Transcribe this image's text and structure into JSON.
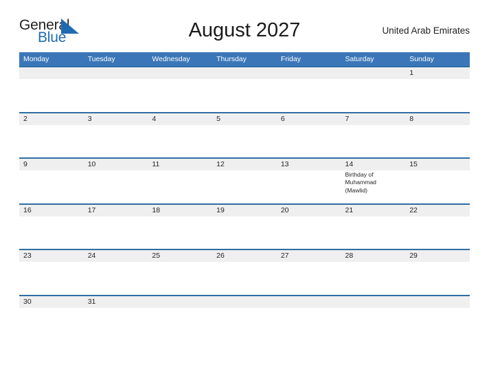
{
  "brand": {
    "name_part1": "General",
    "name_part2": "Blue",
    "color_dark": "#231f20",
    "color_blue": "#1f6bb0"
  },
  "header": {
    "title": "August 2027",
    "region": "United Arab Emirates"
  },
  "theme": {
    "header_bar": "#3b76b8",
    "row_divider": "#2e6da4",
    "day_band": "#efefef",
    "page_background": "#ffffff",
    "text": "#231f20"
  },
  "calendar": {
    "month": "August",
    "year": "2027",
    "day_headers": [
      "Monday",
      "Tuesday",
      "Wednesday",
      "Thursday",
      "Friday",
      "Saturday",
      "Sunday"
    ],
    "weeks": [
      {
        "days": [
          {
            "num": "",
            "events": []
          },
          {
            "num": "",
            "events": []
          },
          {
            "num": "",
            "events": []
          },
          {
            "num": "",
            "events": []
          },
          {
            "num": "",
            "events": []
          },
          {
            "num": "",
            "events": []
          },
          {
            "num": "1",
            "events": []
          }
        ]
      },
      {
        "days": [
          {
            "num": "2",
            "events": []
          },
          {
            "num": "3",
            "events": []
          },
          {
            "num": "4",
            "events": []
          },
          {
            "num": "5",
            "events": []
          },
          {
            "num": "6",
            "events": []
          },
          {
            "num": "7",
            "events": []
          },
          {
            "num": "8",
            "events": []
          }
        ]
      },
      {
        "days": [
          {
            "num": "9",
            "events": []
          },
          {
            "num": "10",
            "events": []
          },
          {
            "num": "11",
            "events": []
          },
          {
            "num": "12",
            "events": []
          },
          {
            "num": "13",
            "events": []
          },
          {
            "num": "14",
            "events": [
              "Birthday of",
              "Muhammad",
              "(Mawlid)"
            ]
          },
          {
            "num": "15",
            "events": []
          }
        ]
      },
      {
        "days": [
          {
            "num": "16",
            "events": []
          },
          {
            "num": "17",
            "events": []
          },
          {
            "num": "18",
            "events": []
          },
          {
            "num": "19",
            "events": []
          },
          {
            "num": "20",
            "events": []
          },
          {
            "num": "21",
            "events": []
          },
          {
            "num": "22",
            "events": []
          }
        ]
      },
      {
        "days": [
          {
            "num": "23",
            "events": []
          },
          {
            "num": "24",
            "events": []
          },
          {
            "num": "25",
            "events": []
          },
          {
            "num": "26",
            "events": []
          },
          {
            "num": "27",
            "events": []
          },
          {
            "num": "28",
            "events": []
          },
          {
            "num": "29",
            "events": []
          }
        ]
      },
      {
        "days": [
          {
            "num": "30",
            "events": []
          },
          {
            "num": "31",
            "events": []
          },
          {
            "num": "",
            "events": []
          },
          {
            "num": "",
            "events": []
          },
          {
            "num": "",
            "events": []
          },
          {
            "num": "",
            "events": []
          },
          {
            "num": "",
            "events": []
          }
        ]
      }
    ]
  }
}
